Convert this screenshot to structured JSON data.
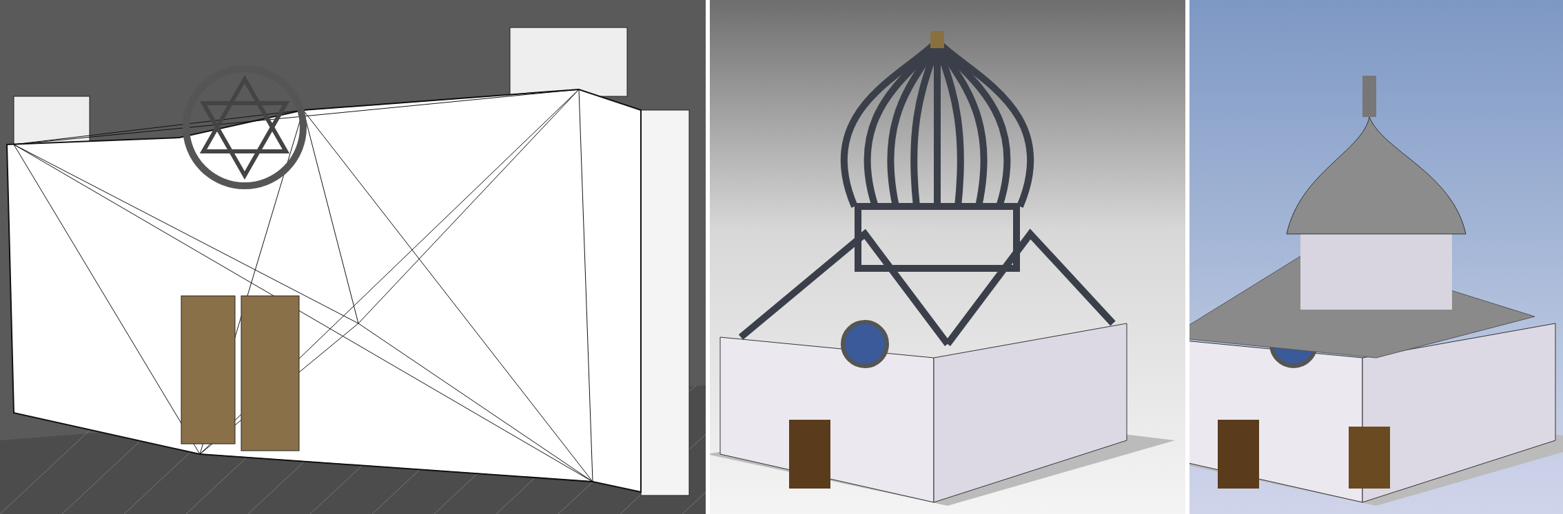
{
  "panels": [
    {
      "kind": "wireframe"
    },
    {
      "kind": "frame"
    },
    {
      "kind": "render"
    }
  ]
}
